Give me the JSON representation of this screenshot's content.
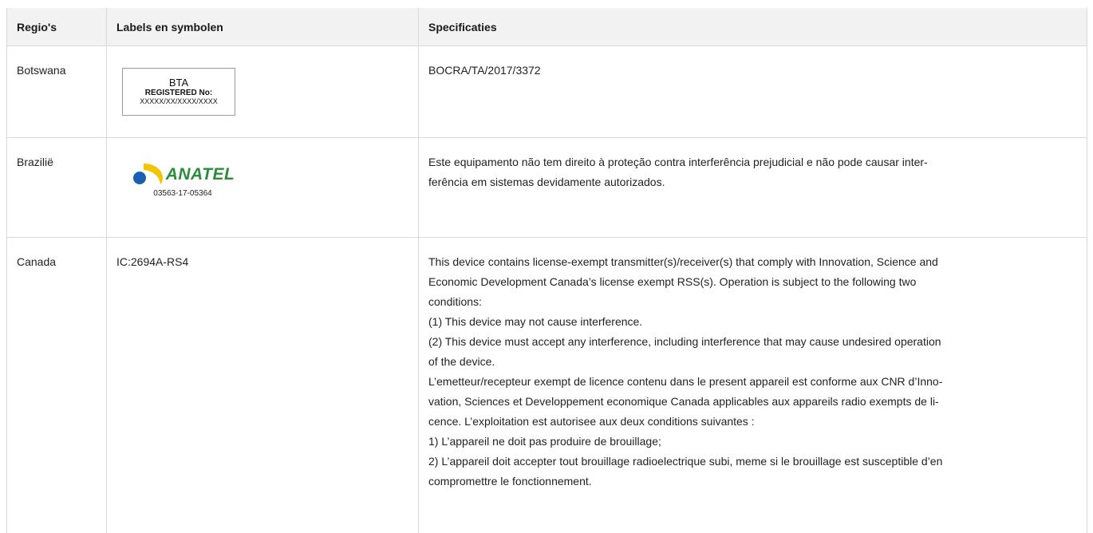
{
  "headers": {
    "region": "Regio's",
    "labels": "Labels en symbolen",
    "specs": "Specificaties"
  },
  "rows": [
    {
      "region": "Botswana",
      "label": {
        "type": "bta-box",
        "title": "BTA",
        "registered": "REGISTERED No:",
        "number": "XXXXX/XX/XXXX/XXXX"
      },
      "spec_lines": [
        "BOCRA/TA/2017/3372"
      ]
    },
    {
      "region": "Brazilië",
      "label": {
        "type": "anatel-logo",
        "brand": "ANATEL",
        "number": "03563-17-05364",
        "colors": {
          "blue": "#1a5fb4",
          "yellow": "#f5c400",
          "green": "#2c8c3c"
        }
      },
      "spec_lines": [
        "Este equipamento não tem direito à proteção contra interferência prejudicial e não pode causar inter-",
        "ferência em sistemas devidamente autorizados."
      ]
    },
    {
      "region": "Canada",
      "label": {
        "type": "text",
        "text": "IC:2694A-RS4"
      },
      "spec_lines": [
        "This device contains license-exempt transmitter(s)/receiver(s) that comply with Innovation, Science and",
        "Economic Development Canada’s license exempt RSS(s). Operation is subject to the following two",
        "conditions:",
        "(1) This device may not cause interference.",
        "(2) This device must accept any interference, including interference that may cause undesired operation",
        "of the device.",
        "L’emetteur/recepteur exempt de licence contenu dans le present appareil est conforme aux CNR d’Inno-",
        "vation, Sciences et Developpement economique Canada applicables aux appareils radio exempts de li-",
        "cence. L’exploitation est autorisee aux deux conditions suivantes :",
        "1) L’appareil ne doit pas produire de brouillage;",
        "2) L’appareil doit accepter tout brouillage radioelectrique subi, meme si le brouillage est susceptible d’en",
        "compromettre le fonctionnement."
      ]
    }
  ]
}
